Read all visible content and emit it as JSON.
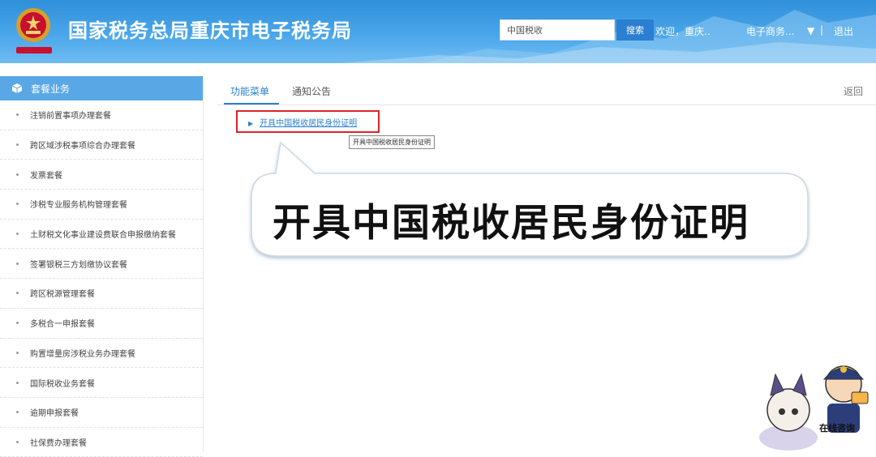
{
  "header": {
    "title": "国家税务总局重庆市电子税务局",
    "search_value": "中国税收",
    "search_button": "搜索",
    "welcome": "欢迎，重庆..",
    "user": "电子商务...",
    "dropdown_icon": "▼",
    "divider": "|",
    "logout": "退出",
    "emblem_icon": "national-emblem-icon"
  },
  "sidebar": {
    "title": "套餐业务",
    "items": [
      "注销前置事项办理套餐",
      "跨区域涉税事项综合办理套餐",
      "发票套餐",
      "涉税专业服务机构管理套餐",
      "土财税文化事业建设费联合申报缴纳套餐",
      "签署银税三方划缴协议套餐",
      "跨区税源管理套餐",
      "多税合一申报套餐",
      "购置增量房涉税业务办理套餐",
      "国际税收业务套餐",
      "逾期申报套餐",
      "社保费办理套餐"
    ]
  },
  "main": {
    "tabs": [
      "功能菜单",
      "通知公告"
    ],
    "active_tab": "功能菜单",
    "back_label": "返回",
    "menu_link": "开具中国税收居民身份证明",
    "tooltip": "开具中国税收居民身份证明",
    "callout": "开具中国税收居民身份证明"
  },
  "mascot": {
    "label": "在线咨询"
  },
  "colors": {
    "header_blue": "#3a98e0",
    "accent": "#2a7fd0",
    "highlight_red": "#d9252a",
    "sidebar_header": "#5aa7e6"
  }
}
